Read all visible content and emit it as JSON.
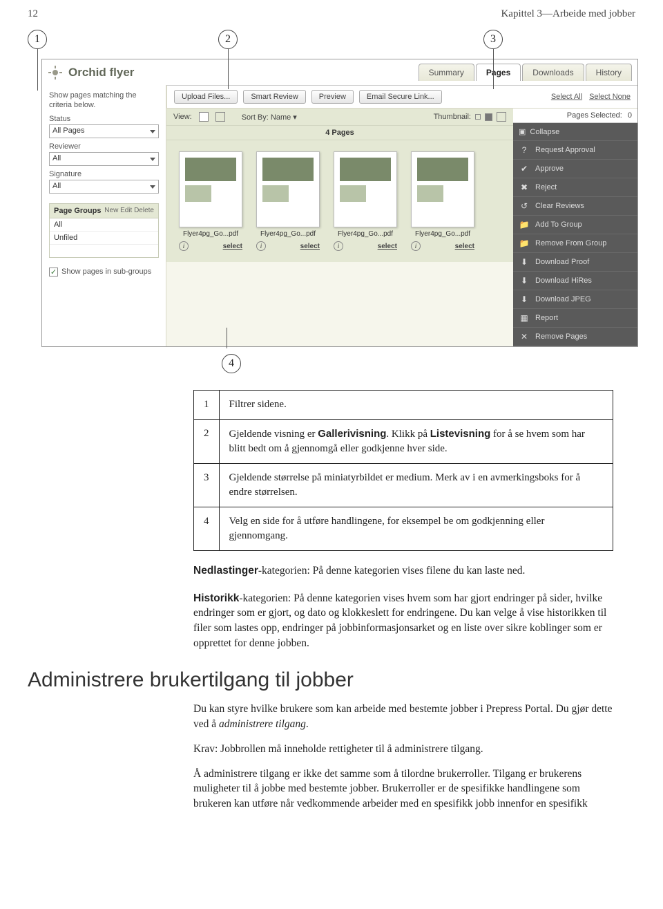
{
  "page_number": "12",
  "chapter_label": "Kapittel 3—Arbeide med jobber",
  "callouts": {
    "c1": "1",
    "c2": "2",
    "c3": "3",
    "c4": "4"
  },
  "screenshot": {
    "title": "Orchid flyer",
    "tabs": [
      "Summary",
      "Pages",
      "Downloads",
      "History"
    ],
    "left": {
      "intro": "Show pages matching the criteria below.",
      "status_label": "Status",
      "status_value": "All Pages",
      "reviewer_label": "Reviewer",
      "reviewer_value": "All",
      "signature_label": "Signature",
      "signature_value": "All",
      "groups_title": "Page Groups",
      "groups_actions": "New Edit Delete",
      "groups": [
        "All",
        "Unfiled"
      ],
      "show_sub": "Show pages in sub-groups"
    },
    "toolbar": {
      "upload": "Upload Files...",
      "smart": "Smart Review",
      "preview": "Preview",
      "email": "Email Secure Link...",
      "select_all": "Select All",
      "select_none": "Select None",
      "pages_selected_label": "Pages Selected:",
      "pages_selected_count": "0"
    },
    "viewbar": {
      "view_label": "View:",
      "sort_label": "Sort By: Name ▾",
      "thumb_label": "Thumbnail:"
    },
    "pages_count": "4 Pages",
    "thumbs": [
      {
        "name": "Flyer4pg_Go...pdf",
        "select": "select"
      },
      {
        "name": "Flyer4pg_Go...pdf",
        "select": "select"
      },
      {
        "name": "Flyer4pg_Go...pdf",
        "select": "select"
      },
      {
        "name": "Flyer4pg_Go...pdf",
        "select": "select"
      }
    ],
    "right": {
      "collapse": "Collapse",
      "items": [
        "Request Approval",
        "Approve",
        "Reject",
        "Clear Reviews",
        "Add To Group",
        "Remove From Group",
        "Download Proof",
        "Download HiRes",
        "Download JPEG",
        "Report",
        "Remove Pages"
      ],
      "icons": [
        "?",
        "✔",
        "✖",
        "↺",
        "📁",
        "📁",
        "⬇",
        "⬇",
        "⬇",
        "▦",
        "✕"
      ]
    }
  },
  "legend": {
    "r1n": "1",
    "r1t": "Filtrer sidene.",
    "r2n": "2",
    "r2t_a": "Gjeldende visning er ",
    "r2t_b": "Gallerivisning",
    "r2t_c": ". Klikk på ",
    "r2t_d": "Listevisning",
    "r2t_e": " for å se hvem som har blitt bedt om å gjennomgå eller godkjenne hver side.",
    "r3n": "3",
    "r3t": "Gjeldende størrelse på miniatyrbildet er medium. Merk av i en avmerkingsboks for å endre størrelsen.",
    "r4n": "4",
    "r4t": "Velg en side for å utføre handlingene, for eksempel be om godkjenning eller gjennomgang."
  },
  "paras": {
    "p1a": "Nedlastinger",
    "p1b": "-kategorien: På denne kategorien vises filene du kan laste ned.",
    "p2a": "Historikk",
    "p2b": "-kategorien: På denne kategorien vises hvem som har gjort endringer på sider, hvilke endringer som er gjort, og dato og klokkeslett for endringene. Du kan velge å vise historikken til filer som lastes opp, endringer på jobbinformasjonsarket og en liste over sikre koblinger som er opprettet for denne jobben."
  },
  "heading": "Administrere brukertilgang til jobber",
  "body": {
    "p1a": "Du kan styre hvilke brukere som kan arbeide med bestemte jobber i Prepress Portal. Du gjør dette ved å ",
    "p1b": "administrere tilgang",
    "p1c": ".",
    "p2": "Krav: Jobbrollen må inneholde rettigheter til å administrere tilgang.",
    "p3": "Å administrere tilgang er ikke det samme som å tilordne brukerroller. Tilgang er brukerens muligheter til å jobbe med bestemte jobber. Brukerroller er de spesifikke handlingene som brukeren kan utføre når vedkommende arbeider med en spesifikk jobb innenfor en spesifikk"
  }
}
